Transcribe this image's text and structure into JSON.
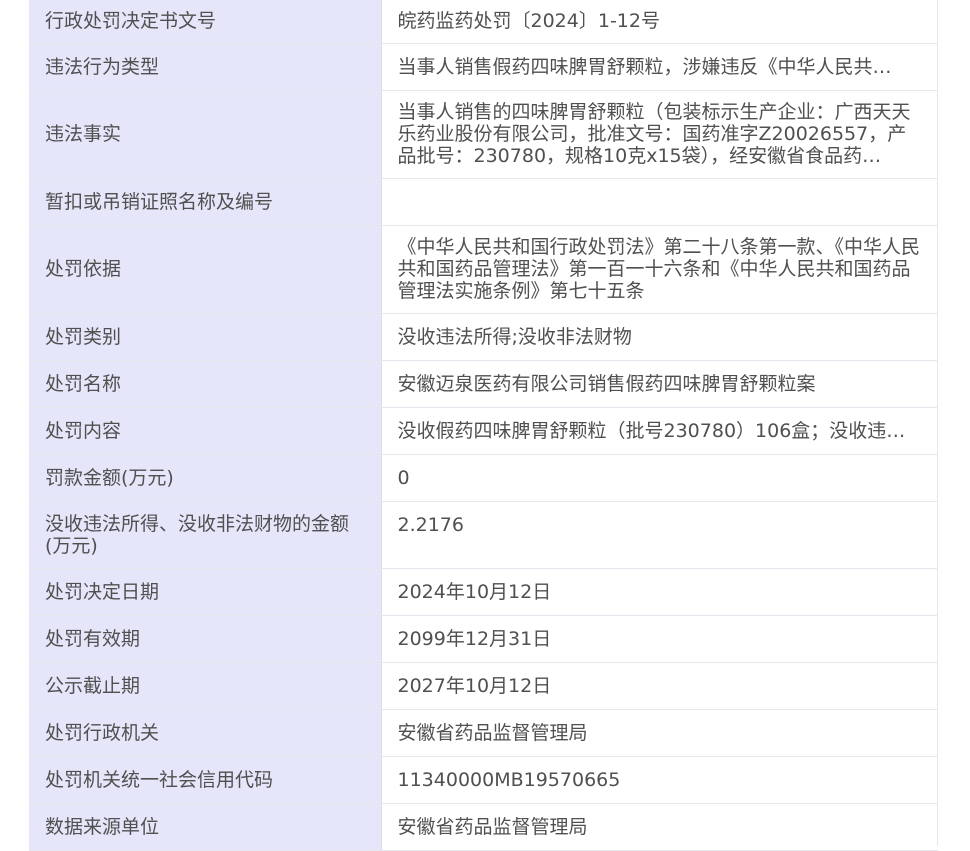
{
  "rows": [
    {
      "label": "行政处罚决定书文号",
      "value": "皖药监药处罚〔2024〕1-12号"
    },
    {
      "label": "违法行为类型",
      "value": "当事人销售假药四味脾胃舒颗粒，涉嫌违反《中华人民共…"
    },
    {
      "label": "违法事实",
      "value": "当事人销售的四味脾胃舒颗粒（包装标示生产企业：广西天天乐药业股份有限公司，批准文号：国药准字Z20026557，产品批号：230780，规格10克x15袋），经安徽省食品药…"
    },
    {
      "label": "暂扣或吊销证照名称及编号",
      "value": ""
    },
    {
      "label": "处罚依据",
      "value": "《中华人民共和国行政处罚法》第二十八条第一款、《中华人民共和国药品管理法》第一百一十六条和《中华人民共和国药品管理法实施条例》第七十五条"
    },
    {
      "label": "处罚类别",
      "value": "没收违法所得;没收非法财物"
    },
    {
      "label": "处罚名称",
      "value": "安徽迈泉医药有限公司销售假药四味脾胃舒颗粒案"
    },
    {
      "label": "处罚内容",
      "value": "没收假药四味脾胃舒颗粒（批号230780）106盒；没收违…"
    },
    {
      "label": "罚款金额(万元)",
      "value": "0"
    },
    {
      "label": "没收违法所得、没收非法财物的金额(万元)",
      "value": "2.2176"
    },
    {
      "label": "处罚决定日期",
      "value": "2024年10月12日"
    },
    {
      "label": "处罚有效期",
      "value": "2099年12月31日"
    },
    {
      "label": "公示截止期",
      "value": "2027年10月12日"
    },
    {
      "label": "处罚行政机关",
      "value": "安徽省药品监督管理局"
    },
    {
      "label": "处罚机关统一社会信用代码",
      "value": "11340000MB19570665"
    },
    {
      "label": "数据来源单位",
      "value": "安徽省药品监督管理局"
    }
  ]
}
